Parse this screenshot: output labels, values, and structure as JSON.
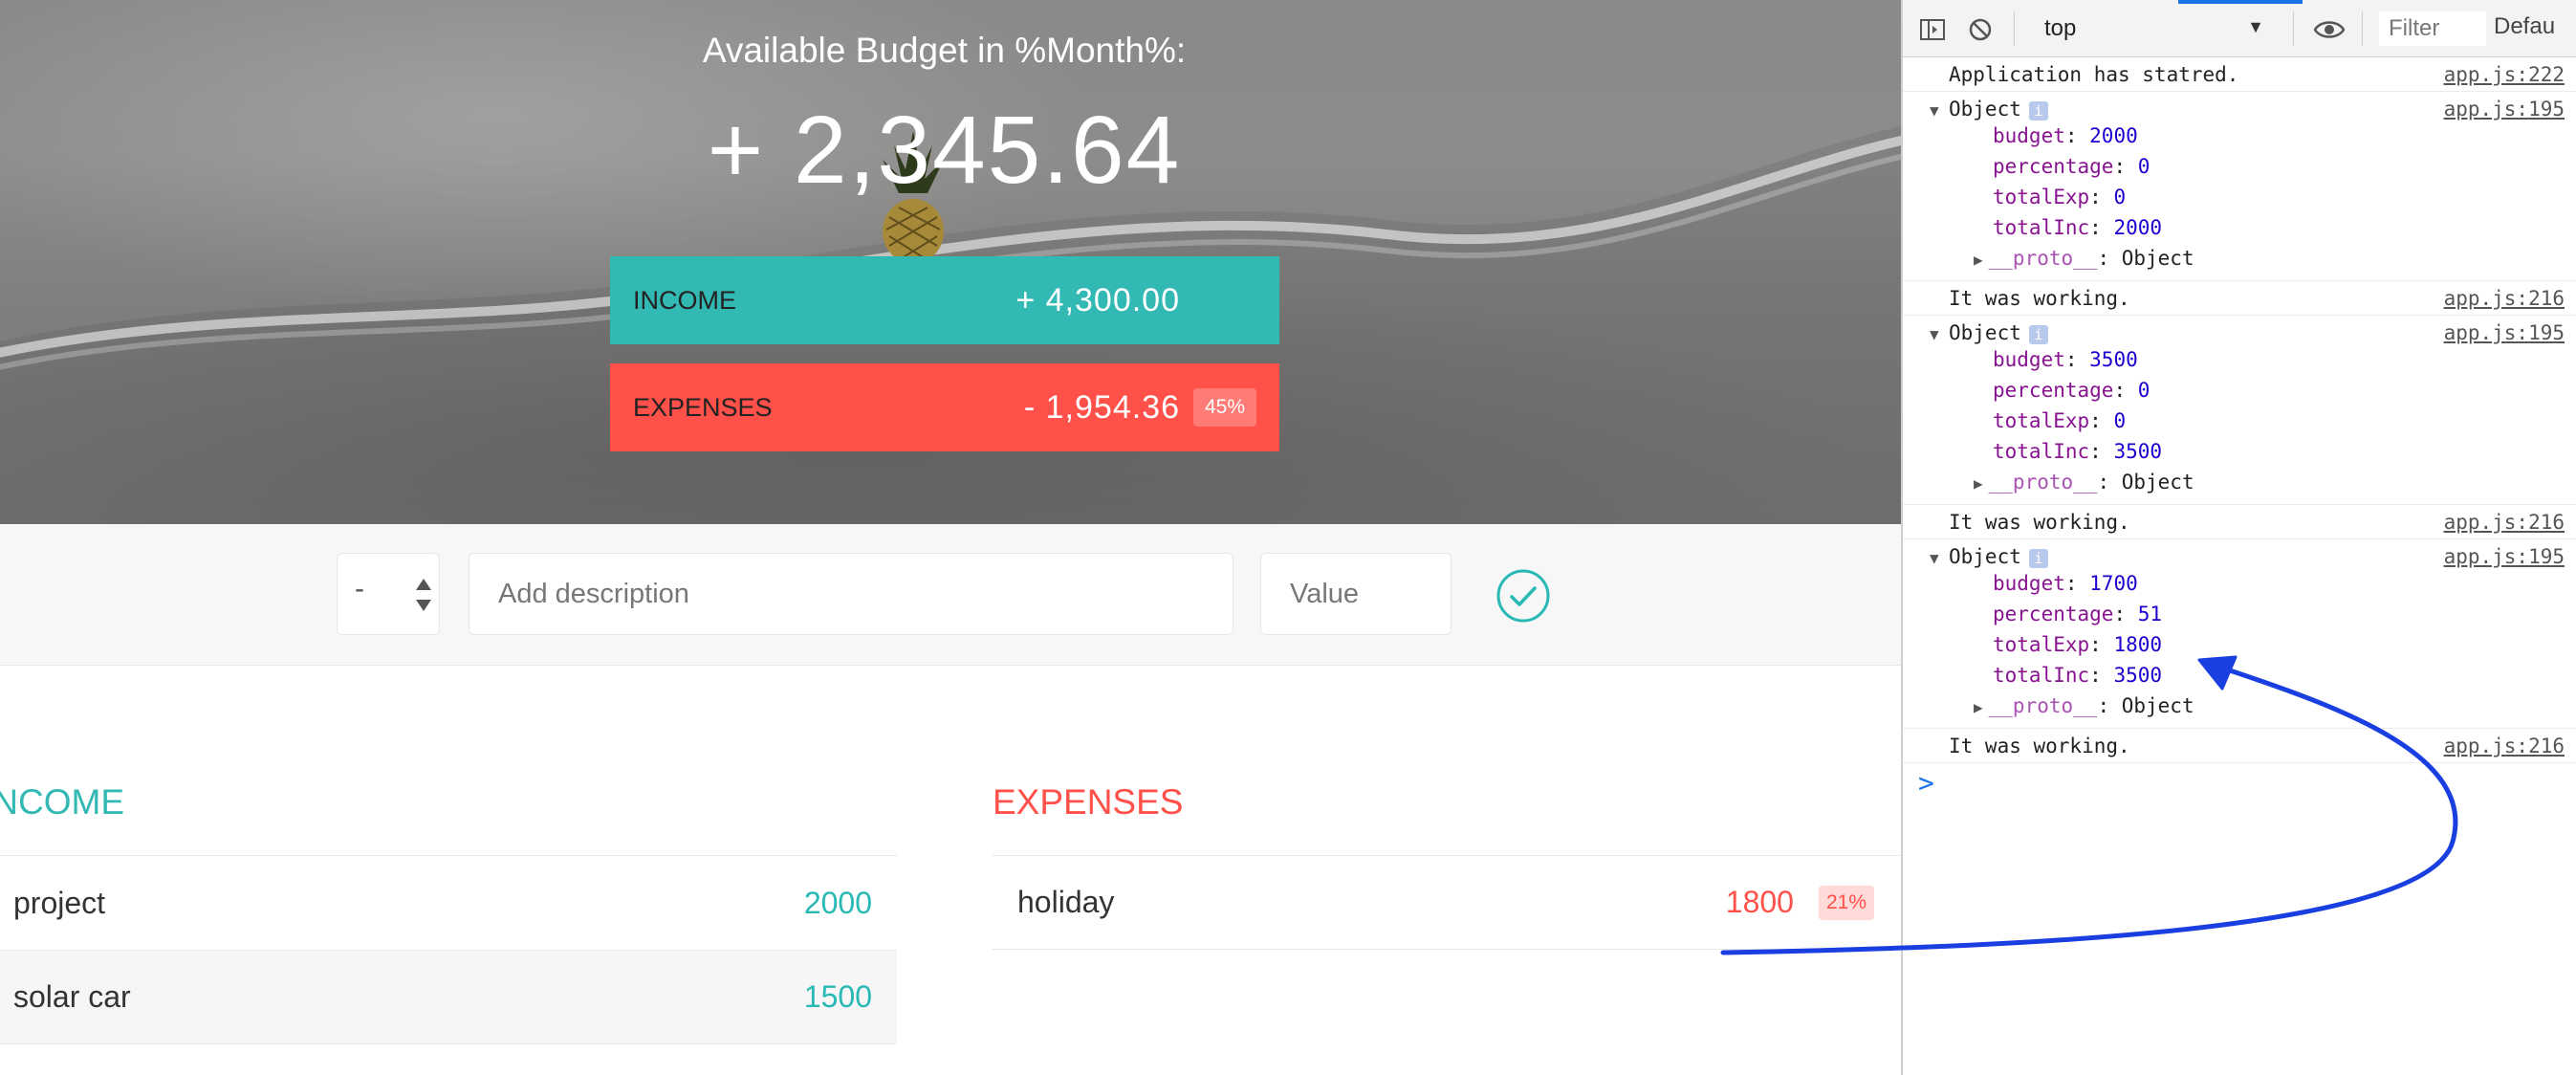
{
  "app": {
    "budget_title": "Available Budget in %Month%:",
    "budget_value": "+ 2,345.64",
    "income_summary": {
      "label": "Income",
      "value": "+ 4,300.00"
    },
    "expenses_summary": {
      "label": "Expenses",
      "value": "- 1,954.36",
      "percentage": "45%"
    },
    "add_form": {
      "type_value": "-",
      "description_placeholder": "Add description",
      "value_placeholder": "Value"
    },
    "income_title": "Income",
    "expenses_title": "Expenses",
    "income_items": [
      {
        "description": "project",
        "value": "2000"
      },
      {
        "description": "solar car",
        "value": "1500"
      }
    ],
    "expense_items": [
      {
        "description": "holiday",
        "value": "1800",
        "percentage": "21%"
      }
    ],
    "colors": {
      "income": "#33b9b4",
      "expenses": "#ff5049"
    }
  },
  "devtools": {
    "context": "top",
    "filter_placeholder": "Filter",
    "levels": "Defau",
    "console": [
      {
        "type": "log",
        "text": "Application has statred.",
        "source": "app.js:222"
      },
      {
        "type": "object",
        "label": "Object",
        "source": "app.js:195",
        "props": [
          {
            "key": "budget",
            "value": "2000"
          },
          {
            "key": "percentage",
            "value": "0"
          },
          {
            "key": "totalExp",
            "value": "0"
          },
          {
            "key": "totalInc",
            "value": "2000"
          }
        ],
        "proto": {
          "key": "__proto__",
          "value": "Object"
        }
      },
      {
        "type": "log",
        "text": "It was working.",
        "source": "app.js:216"
      },
      {
        "type": "object",
        "label": "Object",
        "source": "app.js:195",
        "props": [
          {
            "key": "budget",
            "value": "3500"
          },
          {
            "key": "percentage",
            "value": "0"
          },
          {
            "key": "totalExp",
            "value": "0"
          },
          {
            "key": "totalInc",
            "value": "3500"
          }
        ],
        "proto": {
          "key": "__proto__",
          "value": "Object"
        }
      },
      {
        "type": "log",
        "text": "It was working.",
        "source": "app.js:216"
      },
      {
        "type": "object",
        "label": "Object",
        "source": "app.js:195",
        "props": [
          {
            "key": "budget",
            "value": "1700"
          },
          {
            "key": "percentage",
            "value": "51"
          },
          {
            "key": "totalExp",
            "value": "1800"
          },
          {
            "key": "totalInc",
            "value": "3500"
          }
        ],
        "proto": {
          "key": "__proto__",
          "value": "Object"
        }
      },
      {
        "type": "log",
        "text": "It was working.",
        "source": "app.js:216"
      }
    ],
    "prompt_symbol": ">"
  },
  "annotation": {
    "color": "#1a3fe0"
  }
}
